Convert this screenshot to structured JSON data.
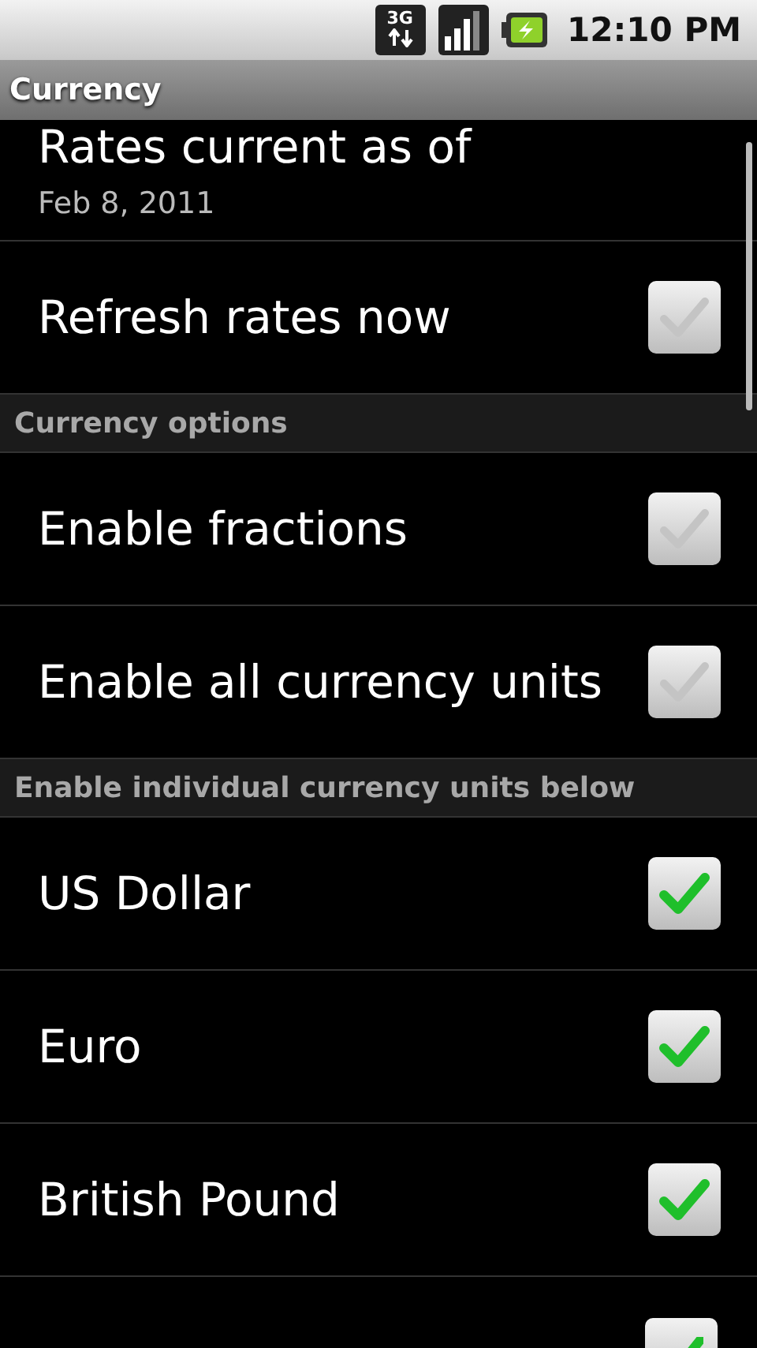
{
  "status_bar": {
    "time": "12:10 PM",
    "network": "3G"
  },
  "title_bar": {
    "title": "Currency"
  },
  "items": [
    {
      "kind": "info",
      "title": "Rates current as of",
      "summary": "Feb 8, 2011"
    },
    {
      "kind": "checkbox",
      "title": "Refresh rates now",
      "checked": false
    },
    {
      "kind": "header",
      "title": "Currency options"
    },
    {
      "kind": "checkbox",
      "title": "Enable fractions",
      "checked": false
    },
    {
      "kind": "checkbox",
      "title": "Enable all currency units",
      "checked": false
    },
    {
      "kind": "header",
      "title": "Enable individual currency units below"
    },
    {
      "kind": "checkbox",
      "title": "US Dollar",
      "checked": true
    },
    {
      "kind": "checkbox",
      "title": "Euro",
      "checked": true
    },
    {
      "kind": "checkbox",
      "title": "British Pound",
      "checked": true
    },
    {
      "kind": "checkbox",
      "checked": true
    }
  ]
}
